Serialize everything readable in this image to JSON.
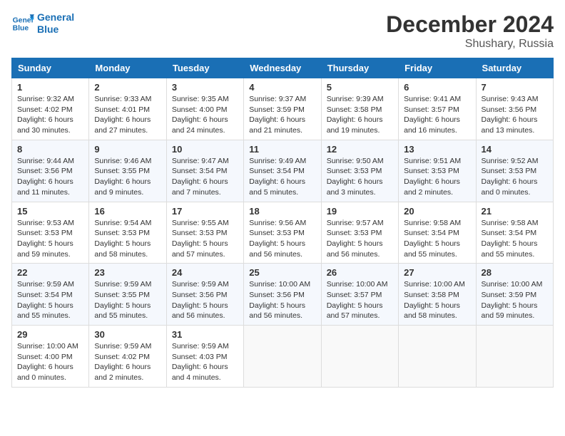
{
  "logo": {
    "line1": "General",
    "line2": "Blue"
  },
  "title": "December 2024",
  "location": "Shushary, Russia",
  "days_of_week": [
    "Sunday",
    "Monday",
    "Tuesday",
    "Wednesday",
    "Thursday",
    "Friday",
    "Saturday"
  ],
  "weeks": [
    [
      {
        "day": "1",
        "sunrise": "9:32 AM",
        "sunset": "4:02 PM",
        "daylight": "6 hours and 30 minutes."
      },
      {
        "day": "2",
        "sunrise": "9:33 AM",
        "sunset": "4:01 PM",
        "daylight": "6 hours and 27 minutes."
      },
      {
        "day": "3",
        "sunrise": "9:35 AM",
        "sunset": "4:00 PM",
        "daylight": "6 hours and 24 minutes."
      },
      {
        "day": "4",
        "sunrise": "9:37 AM",
        "sunset": "3:59 PM",
        "daylight": "6 hours and 21 minutes."
      },
      {
        "day": "5",
        "sunrise": "9:39 AM",
        "sunset": "3:58 PM",
        "daylight": "6 hours and 19 minutes."
      },
      {
        "day": "6",
        "sunrise": "9:41 AM",
        "sunset": "3:57 PM",
        "daylight": "6 hours and 16 minutes."
      },
      {
        "day": "7",
        "sunrise": "9:43 AM",
        "sunset": "3:56 PM",
        "daylight": "6 hours and 13 minutes."
      }
    ],
    [
      {
        "day": "8",
        "sunrise": "9:44 AM",
        "sunset": "3:56 PM",
        "daylight": "6 hours and 11 minutes."
      },
      {
        "day": "9",
        "sunrise": "9:46 AM",
        "sunset": "3:55 PM",
        "daylight": "6 hours and 9 minutes."
      },
      {
        "day": "10",
        "sunrise": "9:47 AM",
        "sunset": "3:54 PM",
        "daylight": "6 hours and 7 minutes."
      },
      {
        "day": "11",
        "sunrise": "9:49 AM",
        "sunset": "3:54 PM",
        "daylight": "6 hours and 5 minutes."
      },
      {
        "day": "12",
        "sunrise": "9:50 AM",
        "sunset": "3:53 PM",
        "daylight": "6 hours and 3 minutes."
      },
      {
        "day": "13",
        "sunrise": "9:51 AM",
        "sunset": "3:53 PM",
        "daylight": "6 hours and 2 minutes."
      },
      {
        "day": "14",
        "sunrise": "9:52 AM",
        "sunset": "3:53 PM",
        "daylight": "6 hours and 0 minutes."
      }
    ],
    [
      {
        "day": "15",
        "sunrise": "9:53 AM",
        "sunset": "3:53 PM",
        "daylight": "5 hours and 59 minutes."
      },
      {
        "day": "16",
        "sunrise": "9:54 AM",
        "sunset": "3:53 PM",
        "daylight": "5 hours and 58 minutes."
      },
      {
        "day": "17",
        "sunrise": "9:55 AM",
        "sunset": "3:53 PM",
        "daylight": "5 hours and 57 minutes."
      },
      {
        "day": "18",
        "sunrise": "9:56 AM",
        "sunset": "3:53 PM",
        "daylight": "5 hours and 56 minutes."
      },
      {
        "day": "19",
        "sunrise": "9:57 AM",
        "sunset": "3:53 PM",
        "daylight": "5 hours and 56 minutes."
      },
      {
        "day": "20",
        "sunrise": "9:58 AM",
        "sunset": "3:54 PM",
        "daylight": "5 hours and 55 minutes."
      },
      {
        "day": "21",
        "sunrise": "9:58 AM",
        "sunset": "3:54 PM",
        "daylight": "5 hours and 55 minutes."
      }
    ],
    [
      {
        "day": "22",
        "sunrise": "9:59 AM",
        "sunset": "3:54 PM",
        "daylight": "5 hours and 55 minutes."
      },
      {
        "day": "23",
        "sunrise": "9:59 AM",
        "sunset": "3:55 PM",
        "daylight": "5 hours and 55 minutes."
      },
      {
        "day": "24",
        "sunrise": "9:59 AM",
        "sunset": "3:56 PM",
        "daylight": "5 hours and 56 minutes."
      },
      {
        "day": "25",
        "sunrise": "10:00 AM",
        "sunset": "3:56 PM",
        "daylight": "5 hours and 56 minutes."
      },
      {
        "day": "26",
        "sunrise": "10:00 AM",
        "sunset": "3:57 PM",
        "daylight": "5 hours and 57 minutes."
      },
      {
        "day": "27",
        "sunrise": "10:00 AM",
        "sunset": "3:58 PM",
        "daylight": "5 hours and 58 minutes."
      },
      {
        "day": "28",
        "sunrise": "10:00 AM",
        "sunset": "3:59 PM",
        "daylight": "5 hours and 59 minutes."
      }
    ],
    [
      {
        "day": "29",
        "sunrise": "10:00 AM",
        "sunset": "4:00 PM",
        "daylight": "6 hours and 0 minutes."
      },
      {
        "day": "30",
        "sunrise": "9:59 AM",
        "sunset": "4:02 PM",
        "daylight": "6 hours and 2 minutes."
      },
      {
        "day": "31",
        "sunrise": "9:59 AM",
        "sunset": "4:03 PM",
        "daylight": "6 hours and 4 minutes."
      },
      null,
      null,
      null,
      null
    ]
  ],
  "labels": {
    "sunrise": "Sunrise:",
    "sunset": "Sunset:",
    "daylight": "Daylight:"
  }
}
